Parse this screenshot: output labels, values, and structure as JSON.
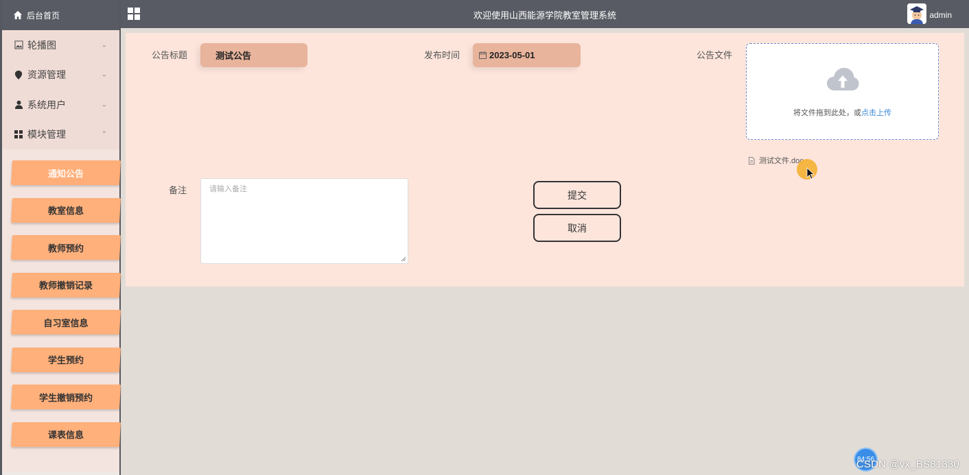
{
  "sidebar": {
    "home_label": "后台首页",
    "menu": [
      {
        "label": "轮播图",
        "icon": "image-icon",
        "expanded": false
      },
      {
        "label": "资源管理",
        "icon": "location-icon",
        "expanded": false
      },
      {
        "label": "系统用户",
        "icon": "user-icon",
        "expanded": false
      },
      {
        "label": "模块管理",
        "icon": "grid-icon",
        "expanded": true
      }
    ],
    "submenu": [
      "通知公告",
      "教室信息",
      "教师预约",
      "教师撤销记录",
      "自习室信息",
      "学生预约",
      "学生撤销预约",
      "课表信息"
    ],
    "active_sub": "通知公告"
  },
  "header": {
    "title": "欢迎使用山西能源学院教室管理系统",
    "user": "admin"
  },
  "form": {
    "title_label": "公告标题",
    "title_value": "测试公告",
    "date_label": "发布时间",
    "date_value": "2023-05-01",
    "file_label": "公告文件",
    "upload_text": "将文件拖到此处，或",
    "upload_link": "点击上传",
    "file_name": "测试文件.doc",
    "remark_label": "备注",
    "remark_placeholder": "请输入备注",
    "submit_label": "提交",
    "cancel_label": "取消"
  },
  "overlay": {
    "watermark": "CSDN @vx_BS81330",
    "badge_text": "84:56"
  },
  "colors": {
    "sidebar_btn": "#ffb07b",
    "topbar": "#585b63",
    "panel": "#fde5dc",
    "input_fill": "#e8b49c",
    "link": "#3b8bd9"
  }
}
